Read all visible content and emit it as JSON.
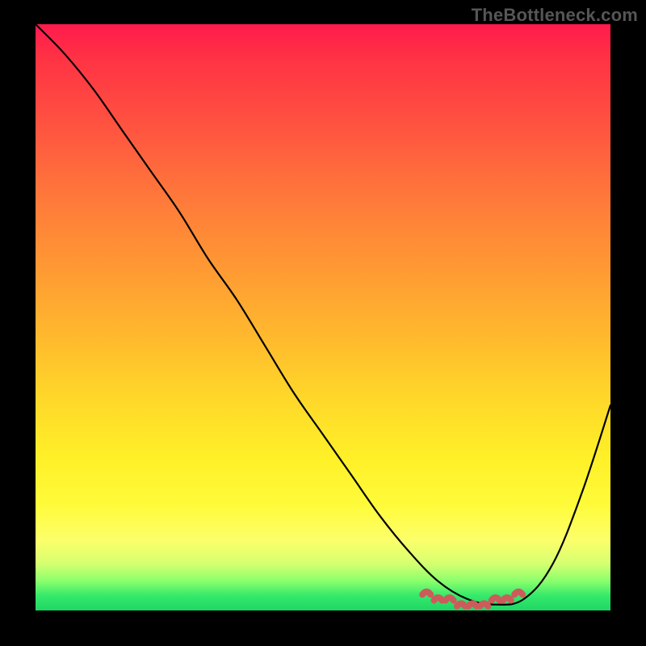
{
  "watermark": "TheBottleneck.com",
  "colors": {
    "page_bg": "#000000",
    "curve": "#000000",
    "bumps": "#cc5c5c",
    "gradient_top": "#ff1a4d",
    "gradient_bottom": "#1fd765"
  },
  "chart_data": {
    "type": "line",
    "title": "",
    "xlabel": "",
    "ylabel": "",
    "xlim": [
      0,
      100
    ],
    "ylim": [
      0,
      100
    ],
    "grid": false,
    "legend": false,
    "background": "vertical-gradient red→green",
    "series": [
      {
        "name": "bottleneck-curve",
        "color": "#000000",
        "x": [
          0,
          5,
          10,
          15,
          20,
          25,
          30,
          35,
          40,
          45,
          50,
          55,
          60,
          65,
          70,
          75,
          80,
          85,
          90,
          95,
          100
        ],
        "values": [
          100,
          95,
          89,
          82,
          75,
          68,
          60,
          53,
          45,
          37,
          30,
          23,
          16,
          10,
          5,
          2,
          1,
          2,
          8,
          20,
          35
        ]
      },
      {
        "name": "optimal-range-marker",
        "color": "#cc5c5c",
        "x": [
          68,
          70,
          72,
          74,
          76,
          78,
          80,
          82,
          84
        ],
        "values": [
          3,
          2,
          2,
          1,
          1,
          1,
          2,
          2,
          3
        ]
      }
    ],
    "annotations": []
  }
}
